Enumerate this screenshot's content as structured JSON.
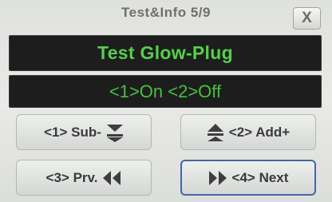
{
  "window": {
    "title": "Test&Info 5/9",
    "close_label": "X"
  },
  "main": {
    "heading": "Test Glow-Plug",
    "options": "<1>On <2>Off"
  },
  "buttons": {
    "sub": {
      "label": "<1> Sub-",
      "icon": "double-chevron-down-icon"
    },
    "add": {
      "label": "<2> Add+",
      "icon": "double-chevron-up-icon"
    },
    "prev": {
      "label": "<3> Prv.",
      "icon": "rewind-icon"
    },
    "next": {
      "label": "<4> Next",
      "icon": "fast-forward-icon"
    }
  },
  "colors": {
    "text_green": "#55d04a",
    "panel_bg": "#1d1d1e",
    "button_text": "#3a3a3c",
    "focus_border": "#4566a2"
  }
}
